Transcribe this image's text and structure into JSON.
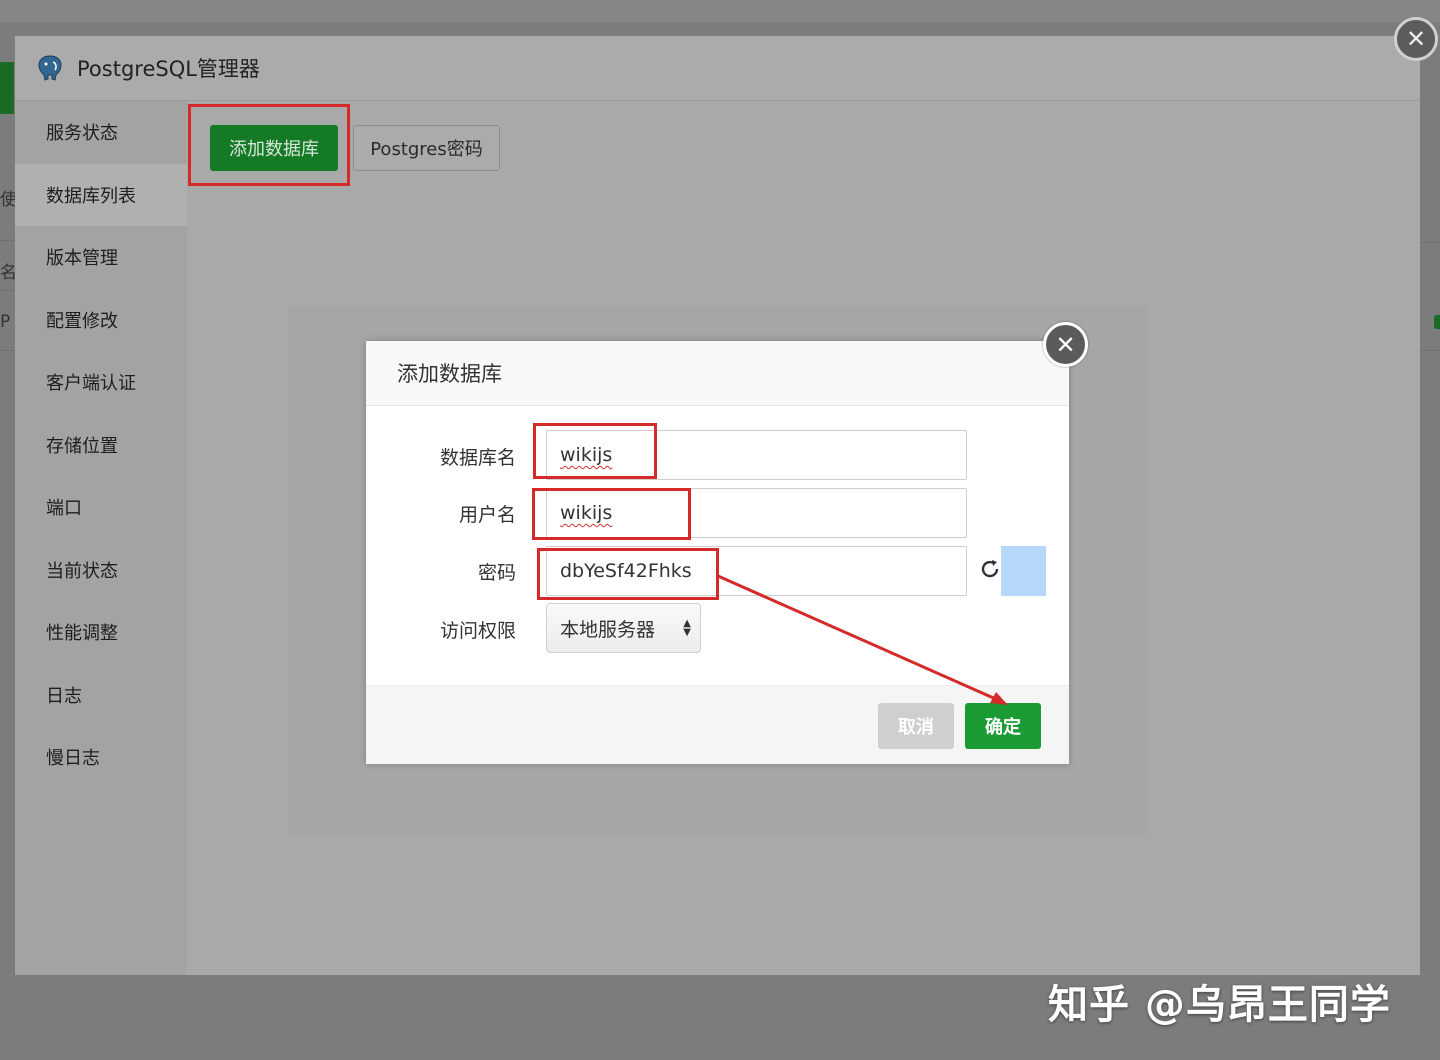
{
  "panel": {
    "title": "PostgreSQL管理器"
  },
  "sidebar": {
    "items": [
      {
        "label": "服务状态"
      },
      {
        "label": "数据库列表"
      },
      {
        "label": "版本管理"
      },
      {
        "label": "配置修改"
      },
      {
        "label": "客户端认证"
      },
      {
        "label": "存储位置"
      },
      {
        "label": "端口"
      },
      {
        "label": "当前状态"
      },
      {
        "label": "性能调整"
      },
      {
        "label": "日志"
      },
      {
        "label": "慢日志"
      }
    ],
    "active_index": 1
  },
  "toolbar": {
    "add_db_label": "添加数据库",
    "pg_password_label": "Postgres密码"
  },
  "background_fragments": [
    "使用",
    "名",
    "P"
  ],
  "modal": {
    "title": "添加数据库",
    "fields": {
      "db_name_label": "数据库名",
      "db_name_value": "wikijs",
      "username_label": "用户名",
      "username_value": "wikijs",
      "password_label": "密码",
      "password_value": "dbYeSf42Fhks",
      "access_label": "访问权限",
      "access_selected": "本地服务器"
    },
    "cancel_label": "取消",
    "ok_label": "确定"
  },
  "icons": {
    "panel_close": "close-icon",
    "modal_close": "close-icon",
    "refresh": "refresh-icon",
    "logo": "postgresql-elephant-icon"
  },
  "colors": {
    "accent_green": "#1a9b33",
    "highlight_red": "#d42a2a",
    "password_swatch": "#b7d7fb"
  },
  "watermark": "知乎 @乌昂王同学"
}
